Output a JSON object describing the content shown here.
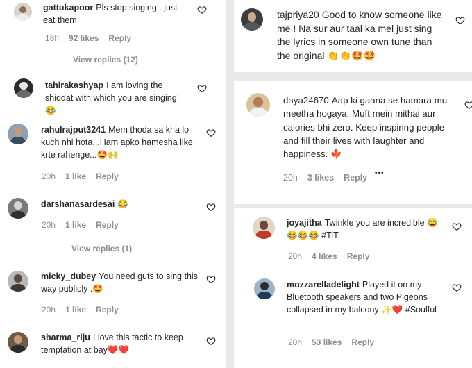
{
  "left": {
    "comments": [
      {
        "user": "gattukapoor",
        "text": "Pls stop singing.. just eat them",
        "time": "18h",
        "likes": "92 likes",
        "reply": "Reply",
        "view_replies": "View replies (12)"
      },
      {
        "user": "tahirakashyap",
        "text": "I am loving the shiddat with which you are singing! 😂"
      },
      {
        "user": "rahulrajput3241",
        "text": "Mem thoda sa kha lo kuch nhi hota...Ham apko hamesha like krte rahenge...🤩🙌",
        "time": "20h",
        "likes": "1 like",
        "reply": "Reply"
      },
      {
        "user": "darshanasardesai",
        "text": "😂",
        "time": "20h",
        "likes": "1 like",
        "reply": "Reply",
        "view_replies": "View replies (1)"
      },
      {
        "user": "micky_dubey",
        "text": "You need guts to sing this way publicly .🤩",
        "time": "20h",
        "likes": "1 like",
        "reply": "Reply"
      },
      {
        "user": "sharma_riju",
        "text": "I love this tactic to keep temptation at bay❤️❤️"
      }
    ]
  },
  "right": {
    "comments": [
      {
        "user": "tajpriya20",
        "text": "Good to know someone like me ! Na sur aur taal ka mel just sing the lyrics in someone own tune than the original 👏👏🤩🤩"
      },
      {
        "user": "daya24670",
        "text": "Aap ki gaana se hamara mu meetha hogaya. Muft mein mithai aur calories bhi zero. Keep inspiring people and fill their lives with laughter and happiness. 🍁",
        "time": "20h",
        "likes": "3 likes",
        "reply": "Reply",
        "more": "•••"
      },
      {
        "user": "joyajitha",
        "text": "Twinkle you are incredible 😂😂😂😂 #TiT",
        "time": "20h",
        "likes": "4 likes",
        "reply": "Reply"
      },
      {
        "user": "mozzarelladelight",
        "text": "Played it on my Bluetooth speakers and two Pigeons collapsed in my balcony ✨❤️ #Soulful",
        "time": "20h",
        "likes": "53 likes",
        "reply": "Reply"
      }
    ]
  },
  "colors": {
    "text": "#262626",
    "muted": "#8e8e8e",
    "heart_red": "#ed4956",
    "background": "#ffffff"
  },
  "icons": [
    "heart-outline-icon",
    "avatar-icon",
    "more-dots-icon"
  ]
}
